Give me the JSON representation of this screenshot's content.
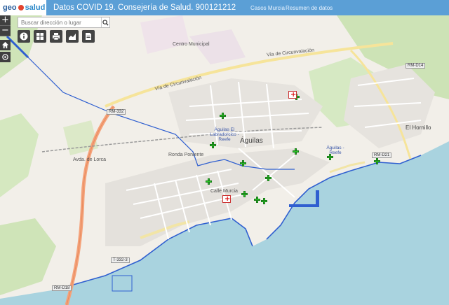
{
  "header": {
    "logo_geo": "geo",
    "logo_salud": "salud",
    "title": "Datos COVID 19. Consejería de Salud. 900121212",
    "nav": [
      {
        "label": "Casos Murcia"
      },
      {
        "label": "Resumen de datos"
      }
    ]
  },
  "controls": {
    "zoom_in": "+",
    "zoom_out": "−",
    "home_icon": "home-icon",
    "locate_icon": "locate-icon"
  },
  "search": {
    "placeholder": "Buscar dirección o lugar",
    "button_icon": "search-icon"
  },
  "toolbar": [
    {
      "icon": "info-icon"
    },
    {
      "icon": "grid-icon"
    },
    {
      "icon": "print-icon"
    },
    {
      "icon": "chart-icon"
    },
    {
      "icon": "document-icon"
    }
  ],
  "map": {
    "town": "Águilas",
    "district": "El Hornillo",
    "pois": [
      {
        "label": "Águilas El Labradorcico - Reefe"
      },
      {
        "label": "Águilas - Reefe"
      }
    ],
    "roads": [
      "RM-332",
      "RM-D14",
      "RM-D21",
      "RM-D18",
      "T-332-3",
      "Avda. de Lorca"
    ],
    "street_labels": [
      "Vía de Circunvalación",
      "Vía de Circunvalación",
      "Ronda Poniente",
      "Calle Murcia",
      "Centro Municipal"
    ],
    "pharmacy_color": "#27c125",
    "sea_color": "#a9d3df",
    "boundary_color": "#2f5fd0"
  }
}
